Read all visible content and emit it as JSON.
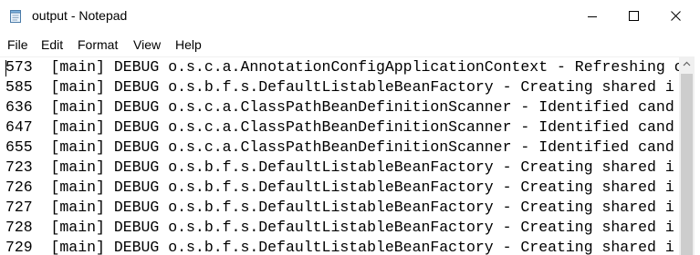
{
  "window": {
    "title": "output - Notepad"
  },
  "menu": {
    "file": "File",
    "edit": "Edit",
    "format": "Format",
    "view": "View",
    "help": "Help"
  },
  "editor": {
    "lines": [
      "573  [main] DEBUG o.s.c.a.AnnotationConfigApplicationContext - Refreshing o",
      "585  [main] DEBUG o.s.b.f.s.DefaultListableBeanFactory - Creating shared i",
      "636  [main] DEBUG o.s.c.a.ClassPathBeanDefinitionScanner - Identified cand",
      "647  [main] DEBUG o.s.c.a.ClassPathBeanDefinitionScanner - Identified cand",
      "655  [main] DEBUG o.s.c.a.ClassPathBeanDefinitionScanner - Identified cand",
      "723  [main] DEBUG o.s.b.f.s.DefaultListableBeanFactory - Creating shared i",
      "726  [main] DEBUG o.s.b.f.s.DefaultListableBeanFactory - Creating shared i",
      "727  [main] DEBUG o.s.b.f.s.DefaultListableBeanFactory - Creating shared i",
      "728  [main] DEBUG o.s.b.f.s.DefaultListableBeanFactory - Creating shared i",
      "729  [main] DEBUG o.s.b.f.s.DefaultListableBeanFactory - Creating shared i"
    ]
  },
  "icons": {
    "app": "notepad-icon",
    "minimize": "minimize-icon",
    "maximize": "maximize-icon",
    "close": "close-icon",
    "scroll_up": "scroll-up-arrow-icon"
  }
}
